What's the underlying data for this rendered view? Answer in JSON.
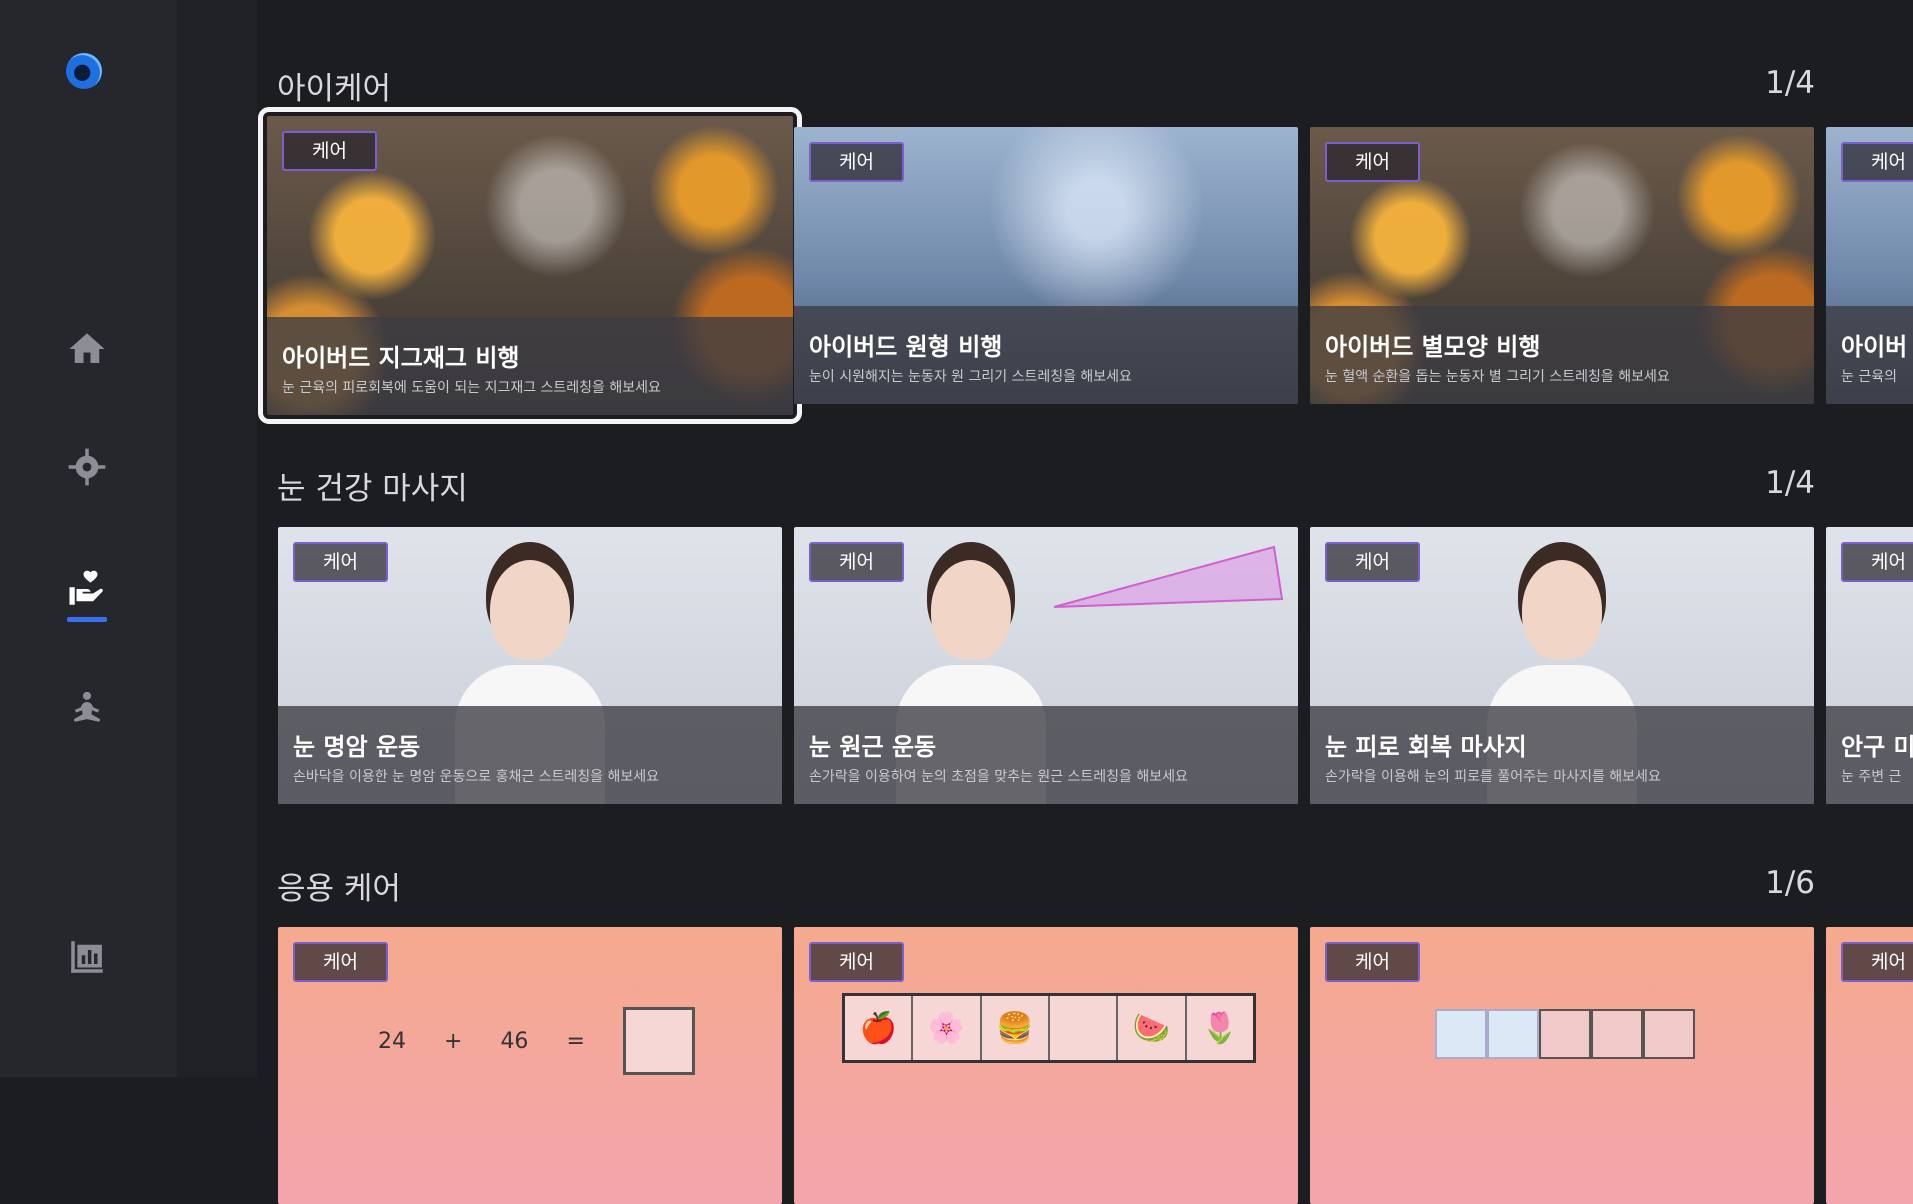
{
  "sidebar": {
    "items": [
      {
        "icon": "home-icon"
      },
      {
        "icon": "target-icon"
      },
      {
        "icon": "care-hand-heart-icon",
        "active": true
      },
      {
        "icon": "meditation-icon"
      },
      {
        "icon": "chart-stats-icon"
      }
    ]
  },
  "badge": "케어",
  "sections": [
    {
      "title": "아이케어",
      "count": "1/4",
      "cards": [
        {
          "title": "아이버드 지그재그 비행",
          "desc": "눈 근육의 피로회복에 도움이 되는 지그재그 스트레칭을 해보세요"
        },
        {
          "title": "아이버드 원형 비행",
          "desc": "눈이 시원해지는 눈동자 원 그리기 스트레칭을 해보세요"
        },
        {
          "title": "아이버드 별모양 비행",
          "desc": "눈 혈액 순환을 돕는 눈동자 별 그리기 스트레칭을 해보세요"
        },
        {
          "title": "아이버",
          "desc": "눈 근육의"
        }
      ]
    },
    {
      "title": "눈 건강 마사지",
      "count": "1/4",
      "cards": [
        {
          "title": "눈 명암 운동",
          "desc": "손바닥을 이용한 눈 명암 운동으로 홍채근 스트레칭을 해보세요"
        },
        {
          "title": "눈 원근 운동",
          "desc": "손가락을 이용하여 눈의 초점을 맞추는 원근 스트레칭을 해보세요"
        },
        {
          "title": "눈 피로 회복 마사지",
          "desc": "손가락을 이용해 눈의 피로를 풀어주는 마사지를 해보세요"
        },
        {
          "title": "안구 미",
          "desc": "눈 주변 근"
        }
      ]
    },
    {
      "title": "응용 케어",
      "count": "1/6",
      "cards": [
        {
          "math": [
            "24",
            "+",
            "46",
            "="
          ]
        },
        {
          "fruits": [
            "🍎",
            "🌸",
            "🍔",
            "",
            "🍉",
            "🌷"
          ]
        },
        {
          "blocks": true
        }
      ]
    }
  ],
  "colors": {
    "accent": "#3a6ff0",
    "badge_border": "#7a5fd0"
  }
}
